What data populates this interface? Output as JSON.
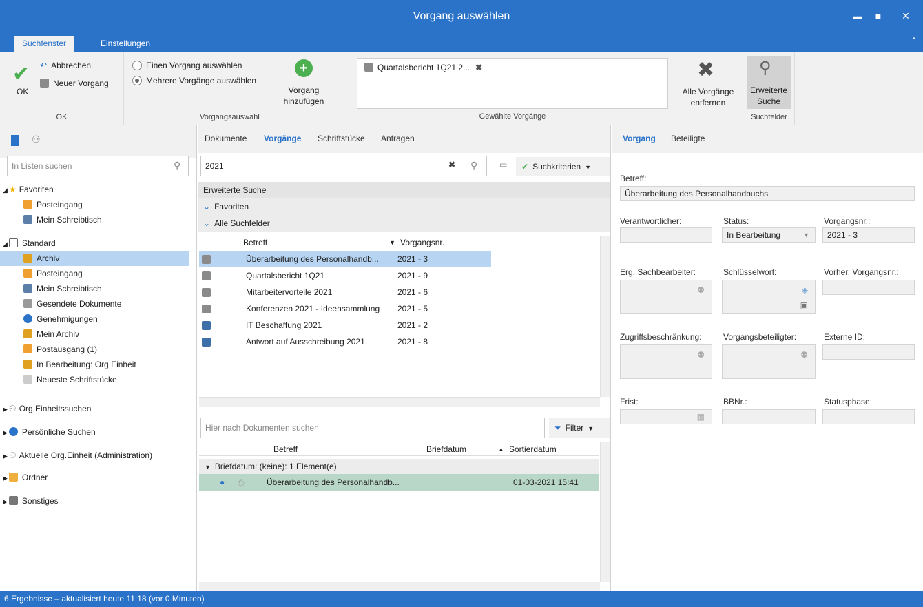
{
  "window": {
    "title": "Vorgang auswählen"
  },
  "ribbon_tabs": [
    "Suchfenster",
    "Einstellungen"
  ],
  "ribbon": {
    "ok_label": "OK",
    "cancel_label": "Abbrechen",
    "new_label": "Neuer Vorgang",
    "group_ok": "OK",
    "radio_single": "Einen Vorgang auswählen",
    "radio_multi": "Mehrere Vorgänge auswählen",
    "add_label_1": "Vorgang",
    "add_label_2": "hinzufügen",
    "group_selection": "Vorgangsauswahl",
    "selected_item": "Quartalsbericht 1Q21 2...",
    "group_selected": "Gewählte Vorgänge",
    "remove_all_1": "Alle Vorgänge",
    "remove_all_2": "entfernen",
    "extended_1": "Erweiterte",
    "extended_2": "Suche",
    "group_search_fields": "Suchfelder"
  },
  "left": {
    "search_placeholder": "In Listen suchen",
    "favorites": "Favoriten",
    "fav_items": [
      "Posteingang",
      "Mein Schreibtisch"
    ],
    "standard": "Standard",
    "std_items": [
      "Archiv",
      "Posteingang",
      "Mein Schreibtisch",
      "Gesendete Dokumente",
      "Genehmigungen",
      "Mein Archiv",
      "Postausgang (1)",
      "In Bearbeitung: Org.Einheit",
      "Neueste Schriftstücke"
    ],
    "groups": [
      "Org.Einheitssuchen",
      "Persönliche Suchen",
      "Aktuelle Org.Einheit (Administration)",
      "Ordner",
      "Sonstiges"
    ]
  },
  "middle": {
    "tabs": [
      "Dokumente",
      "Vorgänge",
      "Schriftstücke",
      "Anfragen"
    ],
    "search_value": "2021",
    "criteria_label": "Suchkriterien",
    "extended_search": "Erweiterte Suche",
    "favorites": "Favoriten",
    "all_fields": "Alle Suchfelder",
    "col_subject": "Betreff",
    "col_number": "Vorgangsnr.",
    "rows": [
      {
        "subject": "Überarbeitung des Personalhandb...",
        "number": "2021 - 3"
      },
      {
        "subject": "Quartalsbericht 1Q21",
        "number": "2021 - 9"
      },
      {
        "subject": "Mitarbeitervorteile 2021",
        "number": "2021 - 6"
      },
      {
        "subject": "Konferenzen 2021 - Ideensammlung",
        "number": "2021 - 5"
      },
      {
        "subject": "IT Beschaffung 2021",
        "number": "2021 - 2"
      },
      {
        "subject": "Antwort auf Ausschreibung 2021",
        "number": "2021 - 8"
      }
    ],
    "doc_search_placeholder": "Hier nach Dokumenten suchen",
    "filter_label": "Filter",
    "doc_col_subject": "Betreff",
    "doc_col_date": "Briefdatum",
    "doc_col_sort": "Sortierdatum",
    "group_row": "Briefdatum: (keine): 1 Element(e)",
    "doc_row": {
      "subject": "Überarbeitung des Personalhandb...",
      "sort_date": "01-03-2021 15:41"
    }
  },
  "right": {
    "tabs": [
      "Vorgang",
      "Beteiligte"
    ],
    "betreff_label": "Betreff:",
    "betreff_value": "Überarbeitung des Personalhandbuchs",
    "verantwortlicher": "Verantwortlicher:",
    "status_label": "Status:",
    "status_value": "In Bearbeitung",
    "vorgangsnr_label": "Vorgangsnr.:",
    "vorgangsnr_value": "2021 - 3",
    "erg_sb": "Erg. Sachbearbeiter:",
    "schluessel": "Schlüsselwort:",
    "vorher": "Vorher. Vorgangsnr.:",
    "zugriff": "Zugriffsbeschränkung:",
    "beteiligter": "Vorgangsbeteiligter:",
    "externe": "Externe ID:",
    "frist": "Frist:",
    "bbnr": "BBNr.:",
    "statusphase": "Statusphase:"
  },
  "status_bar": "6 Ergebnisse – aktualisiert heute 11:18 (vor 0 Minuten)",
  "colors": {
    "accent": "#2b73c9",
    "selected_row": "#b7d5f2",
    "doc_row": "#b9d7c9"
  }
}
